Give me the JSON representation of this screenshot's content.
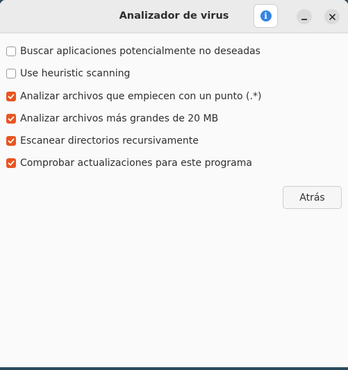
{
  "window": {
    "title": "Analizador de virus"
  },
  "titlebar": {
    "info_icon": "info-icon",
    "info_glyph": "i",
    "minimize_icon": "minimize-icon",
    "close_icon": "close-icon"
  },
  "options": [
    {
      "label": "Buscar aplicaciones potencialmente no deseadas",
      "checked": false
    },
    {
      "label": "Use heuristic scanning",
      "checked": false
    },
    {
      "label": "Analizar archivos que empiecen con un punto (.*)",
      "checked": true
    },
    {
      "label": "Analizar archivos más grandes de 20 MB",
      "checked": true
    },
    {
      "label": "Escanear directorios recursivamente",
      "checked": true
    },
    {
      "label": "Comprobar actualizaciones para este programa",
      "checked": true
    }
  ],
  "back_button": {
    "label": "Atrás"
  },
  "colors": {
    "accent": "#e95420",
    "info_blue": "#3584e4"
  }
}
